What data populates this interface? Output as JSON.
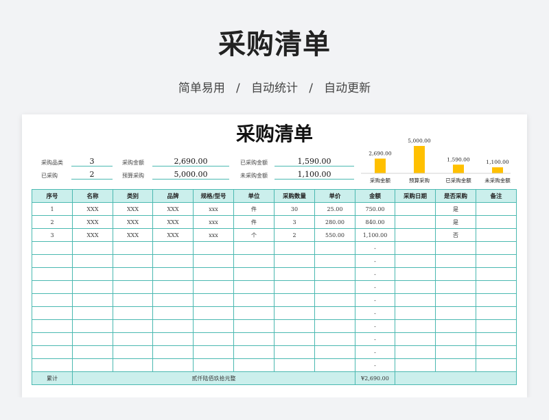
{
  "hero": {
    "title": "采购清单",
    "subtitle": "简单易用   /   自动统计   /   自动更新"
  },
  "sheet": {
    "title": "采购清单",
    "summary": {
      "category_count_label": "采购品类",
      "category_count": "3",
      "purchased_count_label": "已采购",
      "purchased_count": "2",
      "purchase_amount_label": "采购金额",
      "purchase_amount": "2,690.00",
      "budget_label": "预算采购",
      "budget": "5,000.00",
      "purchased_amount_label": "已采购金额",
      "purchased_amount": "1,590.00",
      "unpurchased_amount_label": "未采购金额",
      "unpurchased_amount": "1,100.00"
    },
    "columns": [
      "序号",
      "名称",
      "类别",
      "品牌",
      "规格/型号",
      "单位",
      "采购数量",
      "单价",
      "金额",
      "采购日期",
      "是否采购",
      "备注"
    ],
    "rows": [
      [
        "1",
        "XXX",
        "XXX",
        "XXX",
        "xxx",
        "件",
        "30",
        "25.00",
        "750.00",
        "",
        "是",
        ""
      ],
      [
        "2",
        "XXX",
        "XXX",
        "XXX",
        "xxx",
        "件",
        "3",
        "280.00",
        "840.00",
        "",
        "是",
        ""
      ],
      [
        "3",
        "XXX",
        "XXX",
        "XXX",
        "xxx",
        "个",
        "2",
        "550.00",
        "1,100.00",
        "",
        "否",
        ""
      ],
      [
        "",
        "",
        "",
        "",
        "",
        "",
        "",
        "",
        "-",
        "",
        "",
        ""
      ],
      [
        "",
        "",
        "",
        "",
        "",
        "",
        "",
        "",
        "-",
        "",
        "",
        ""
      ],
      [
        "",
        "",
        "",
        "",
        "",
        "",
        "",
        "",
        "-",
        "",
        "",
        ""
      ],
      [
        "",
        "",
        "",
        "",
        "",
        "",
        "",
        "",
        "-",
        "",
        "",
        ""
      ],
      [
        "",
        "",
        "",
        "",
        "",
        "",
        "",
        "",
        "-",
        "",
        "",
        ""
      ],
      [
        "",
        "",
        "",
        "",
        "",
        "",
        "",
        "",
        "-",
        "",
        "",
        ""
      ],
      [
        "",
        "",
        "",
        "",
        "",
        "",
        "",
        "",
        "-",
        "",
        "",
        ""
      ],
      [
        "",
        "",
        "",
        "",
        "",
        "",
        "",
        "",
        "-",
        "",
        "",
        ""
      ],
      [
        "",
        "",
        "",
        "",
        "",
        "",
        "",
        "",
        "-",
        "",
        "",
        ""
      ],
      [
        "",
        "",
        "",
        "",
        "",
        "",
        "",
        "",
        "-",
        "",
        "",
        ""
      ]
    ],
    "total_row": {
      "label": "累计",
      "amount_words": "贰仟陆佰玖拾元整",
      "amount": "¥2,690.00"
    }
  },
  "chart_data": {
    "type": "bar",
    "categories": [
      "采购金额",
      "预算采购",
      "已采购金额",
      "未采购金额"
    ],
    "values": [
      2690,
      5000,
      1590,
      1100
    ],
    "value_labels": [
      "2,690.00",
      "5,000.00",
      "1,590.00",
      "1,100.00"
    ],
    "ylim": [
      0,
      5000
    ],
    "color": "#ffc000"
  }
}
